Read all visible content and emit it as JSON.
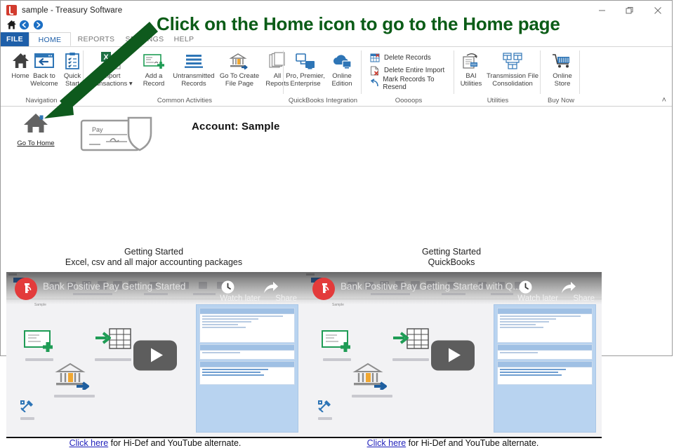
{
  "window": {
    "title": "sample - Treasury Software",
    "app_icon": "treasury-software-icon",
    "minimize": "─",
    "maximize": "❐",
    "close": "✕"
  },
  "quick_access": {
    "home": "home-icon",
    "back": "back-arrow-icon",
    "forward": "forward-arrow-icon"
  },
  "tabs": [
    {
      "label": "FILE",
      "name": "tab-file"
    },
    {
      "label": "HOME",
      "name": "tab-home"
    },
    {
      "label": "REPORTS",
      "name": "tab-reports"
    },
    {
      "label": "SETTINGS",
      "name": "tab-settings"
    },
    {
      "label": "HELP",
      "name": "tab-help"
    }
  ],
  "ribbon": {
    "collapse_glyph": "˄",
    "groups": [
      {
        "label": "Navigation",
        "buttons": [
          {
            "line1": "Home",
            "line2": "",
            "icon": "home-icon"
          },
          {
            "line1": "Back to",
            "line2": "Welcome",
            "icon": "back-to-welcome-icon"
          },
          {
            "line1": "Quick",
            "line2": "Start",
            "icon": "quick-start-clipboard-icon"
          }
        ]
      },
      {
        "label": "Common Activities",
        "buttons": [
          {
            "line1": "Import",
            "line2": "Transactions ▾",
            "icon": "excel-import-icon"
          },
          {
            "line1": "Add a",
            "line2": "Record",
            "icon": "add-record-icon"
          },
          {
            "line1": "Untransmitted",
            "line2": "Records",
            "icon": "untransmitted-records-icon"
          },
          {
            "line1": "Go To Create",
            "line2": "File Page",
            "icon": "bank-file-icon"
          },
          {
            "line1": "All",
            "line2": "Reports",
            "icon": "all-reports-icon"
          }
        ]
      },
      {
        "label": "QuickBooks Integration",
        "buttons": [
          {
            "line1": "Pro, Premier,",
            "line2": "Enterprise",
            "icon": "desktop-quickbooks-icon"
          },
          {
            "line1": "Online",
            "line2": "Edition",
            "icon": "cloud-quickbooks-icon"
          }
        ]
      },
      {
        "label": "Ooooops",
        "small_buttons": [
          {
            "label": "Delete Records",
            "icon": "delete-records-icon"
          },
          {
            "label": "Delete Entire Import",
            "icon": "delete-import-icon"
          },
          {
            "label": "Mark Records To Resend",
            "icon": "undo-resend-icon"
          }
        ]
      },
      {
        "label": "Utilities",
        "buttons": [
          {
            "line1": "BAI",
            "line2": "Utilities",
            "icon": "bai-utilities-icon"
          },
          {
            "line1": "Transmission File",
            "line2": "Consolidation",
            "icon": "file-consolidation-icon"
          }
        ]
      },
      {
        "label": "Buy Now",
        "buttons": [
          {
            "line1": "Online",
            "line2": "Store",
            "icon": "shopping-cart-icon"
          }
        ]
      }
    ]
  },
  "page": {
    "go_to_home": {
      "label": "Go To Home",
      "icon": "home-icon"
    },
    "check_art_icon": "check-shield-icon",
    "check_art_word": "Pay",
    "account_label": "Account: Sample"
  },
  "sections": [
    {
      "heading_line1": "Getting Started",
      "heading_line2": "Excel, csv and all major accounting packages",
      "video": {
        "title": "Bank Positive Pay Getting Started",
        "watch_later": "Watch later",
        "share": "Share",
        "play_icon": "play-button-icon",
        "clock_icon": "watch-later-clock-icon",
        "share_icon": "share-arrow-icon",
        "logo_icon": "treasury-software-logo-icon"
      },
      "footer": {
        "link": "Click here",
        "text": " for Hi-Def and YouTube alternate."
      }
    },
    {
      "heading_line1": "Getting Started",
      "heading_line2": "QuickBooks",
      "video": {
        "title": "Bank Positive Pay Getting Started with Q...",
        "watch_later": "Watch later",
        "share": "Share",
        "play_icon": "play-button-icon",
        "clock_icon": "watch-later-clock-icon",
        "share_icon": "share-arrow-icon",
        "logo_icon": "treasury-software-logo-icon"
      },
      "footer": {
        "link": "Click here",
        "text": " for Hi-Def and YouTube alternate."
      }
    }
  ],
  "annotation": {
    "text": "Click on the Home icon to go to the Home page",
    "color": "#0b5c17",
    "arrow_icon": "annotation-arrow-icon"
  },
  "colors": {
    "accent_blue": "#1e5fa9",
    "annotation_green": "#0b5c17",
    "link_blue": "#2222bb",
    "video_panel_blue": "#b8d3f0"
  }
}
